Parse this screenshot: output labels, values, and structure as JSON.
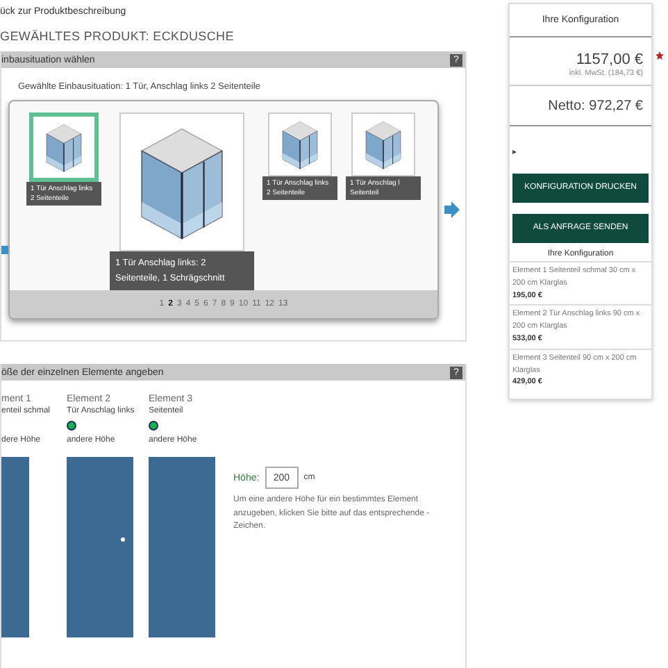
{
  "back_link": "ück zur Produktbeschreibung",
  "heading": "GEWÄHLTES PRODUKT: ECKDUSCHE",
  "situation_panel": {
    "title": "inbausituation wählen",
    "help": "?",
    "selected_text": "Gewählte Einbausituation: 1 Tür, Anschlag links 2 Seitenteile",
    "items": [
      {
        "kind": "small",
        "caption": "1 Tür Anschlag links 2 Seitenteile",
        "selected": true
      },
      {
        "kind": "large",
        "caption": "1 Tür Anschlag links: 2 Seitenteile, 1 Schrägschnitt",
        "selected": false
      },
      {
        "kind": "small",
        "caption": "1 Tür Anschlag links 2 Seitenteile",
        "selected": false
      },
      {
        "kind": "small",
        "caption": "1 Tür Anschlag l Seitenteil",
        "selected": false
      }
    ],
    "pages": [
      {
        "label": "1",
        "selected": false
      },
      {
        "label": "2",
        "selected": true
      },
      {
        "label": "3",
        "selected": false
      },
      {
        "label": "4",
        "selected": false
      },
      {
        "label": "5",
        "selected": false
      },
      {
        "label": "6",
        "selected": false
      },
      {
        "label": "7",
        "selected": false
      },
      {
        "label": "8",
        "selected": false
      },
      {
        "label": "9",
        "selected": false
      },
      {
        "label": "10",
        "selected": false
      },
      {
        "label": "11",
        "selected": false
      },
      {
        "label": "12",
        "selected": false
      },
      {
        "label": "13",
        "selected": false
      }
    ]
  },
  "size_panel": {
    "title": "öße der einzelnen Elemente angeben",
    "help": "?",
    "elements": [
      {
        "kind": "panel",
        "name": "ment 1",
        "type": "enteil schmal",
        "option": "dere Höhe"
      },
      {
        "kind": "door",
        "name": "Element 2",
        "type": "Tür Anschlag links",
        "option": "andere Höhe",
        "checked": false
      },
      {
        "kind": "panel",
        "name": "Element 3",
        "type": "Seitenteil",
        "option": "andere Höhe",
        "checked": false
      }
    ],
    "height_label": "Höhe:",
    "height_value": "200",
    "height_unit": "cm",
    "hint": "Um eine andere Höhe für ein bestimmtes Element anzugeben, klicken Sie bitte auf das entsprechende - Zeichen."
  },
  "sidebar": {
    "title": "Ihre Konfiguration",
    "price": "1157,00 €",
    "vat": "inkl. MwSt. (184,73 €)",
    "net": "Netto: 972,27 €",
    "marker": "▸",
    "buttons": [
      "KONFIGURATION DRUCKEN",
      "ALS ANFRAGE SENDEN"
    ],
    "summary_title": "Ihre Konfiguration",
    "lines": [
      {
        "text": "Element 1 Seitenteil schmal 30 cm x 200 cm Klarglas",
        "price": "195,00 €"
      },
      {
        "text": "Element 2 Tür Anschlag links 90 cm x 200 cm Klarglas",
        "price": "533,00 €"
      },
      {
        "text": "Element 3 Seitenteil 90 cm x 200 cm Klarglas",
        "price": "429,00 €"
      }
    ]
  }
}
